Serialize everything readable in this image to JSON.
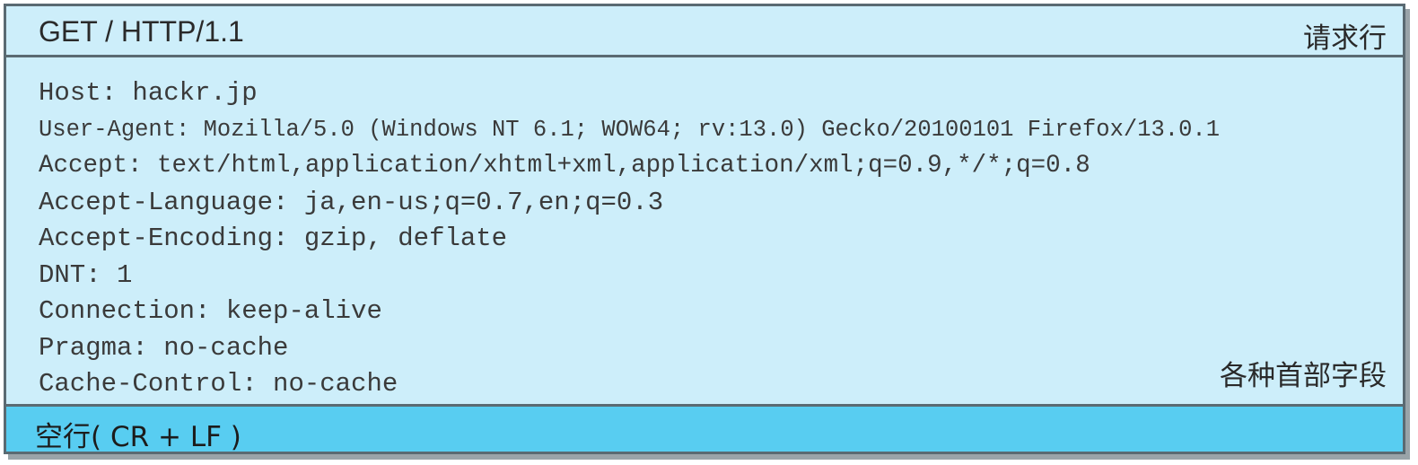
{
  "request_line": {
    "text": "GET / HTTP/1.1",
    "label": "请求行"
  },
  "headers": {
    "lines": [
      "Host: hackr.jp",
      "User-Agent: Mozilla/5.0 (Windows NT 6.1; WOW64; rv:13.0) Gecko/20100101 Firefox/13.0.1",
      "Accept: text/html,application/xhtml+xml,application/xml;q=0.9,*/*;q=0.8",
      "Accept-Language: ja,en-us;q=0.7,en;q=0.3",
      "Accept-Encoding: gzip, deflate",
      "DNT: 1",
      "Connection: keep-alive",
      "Pragma: no-cache",
      "Cache-Control: no-cache"
    ],
    "label": "各种首部字段"
  },
  "blank_line": {
    "text": "空行( CR + LF )"
  },
  "colors": {
    "panel_background": "#cdeefa",
    "blank_line_background": "#58cdf1",
    "border": "#5a6a72",
    "text": "#2a2a2a"
  }
}
